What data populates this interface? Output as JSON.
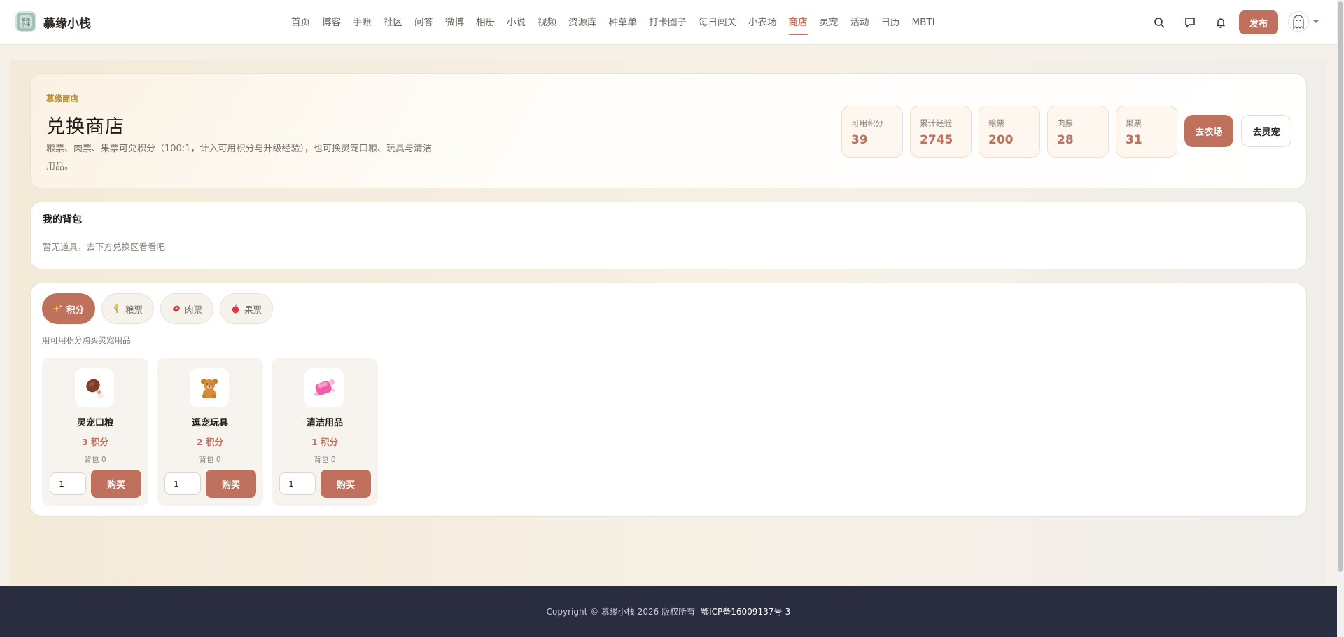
{
  "header": {
    "logo_mark": "慕缘\n小栈",
    "site_name": "慕缘小栈",
    "nav": [
      "首页",
      "博客",
      "手账",
      "社区",
      "问答",
      "微博",
      "相册",
      "小说",
      "视频",
      "资源库",
      "种草单",
      "打卡圈子",
      "每日闯关",
      "小农场",
      "商店",
      "灵宠",
      "活动",
      "日历",
      "MBTI"
    ],
    "active_nav": "商店",
    "publish_label": "发布",
    "icons": [
      "search-icon",
      "message-icon",
      "bell-icon",
      "ghost-avatar-icon"
    ]
  },
  "hero": {
    "kicker": "慕缘商店",
    "title": "兑换商店",
    "description": "粮票、肉票、果票可兑积分（100:1，计入可用积分与升级经验），也可换灵宠口粮、玩具与清洁用品。",
    "stats": [
      {
        "label": "可用积分",
        "value": "39"
      },
      {
        "label": "累计经验",
        "value": "2745"
      },
      {
        "label": "粮票",
        "value": "200"
      },
      {
        "label": "肉票",
        "value": "28"
      },
      {
        "label": "果票",
        "value": "31"
      }
    ],
    "farm_button": "去农场",
    "pet_button": "去灵宠"
  },
  "bag": {
    "title": "我的背包",
    "empty_text": "暂无道具，去下方兑换区看看吧"
  },
  "shop": {
    "tabs": [
      {
        "label": "积分",
        "icon": "sparkles-icon",
        "active": true
      },
      {
        "label": "粮票",
        "icon": "grain-icon",
        "active": false
      },
      {
        "label": "肉票",
        "icon": "meat-icon",
        "active": false
      },
      {
        "label": "果票",
        "icon": "apple-icon",
        "active": false
      }
    ],
    "hint": "用可用积分购买灵宠用品",
    "items": [
      {
        "name": "灵宠口粮",
        "price": "3 积分",
        "bag": "背包 0",
        "qty": "1",
        "buy": "购买",
        "icon": "meat-drumstick-icon"
      },
      {
        "name": "逗宠玩具",
        "price": "2 积分",
        "bag": "背包 0",
        "qty": "1",
        "buy": "购买",
        "icon": "teddy-bear-icon"
      },
      {
        "name": "清洁用品",
        "price": "1 积分",
        "bag": "背包 0",
        "qty": "1",
        "buy": "购买",
        "icon": "soap-icon"
      }
    ]
  },
  "footer": {
    "copyright": "Copyright © 慕缘小栈 2026 版权所有",
    "icp": "鄂ICP备16009137号-3"
  },
  "colors": {
    "accent": "#c0715d",
    "kicker": "#b98a33",
    "footer_bg": "#2a2c40",
    "page_bg": "#f6f1e8"
  }
}
